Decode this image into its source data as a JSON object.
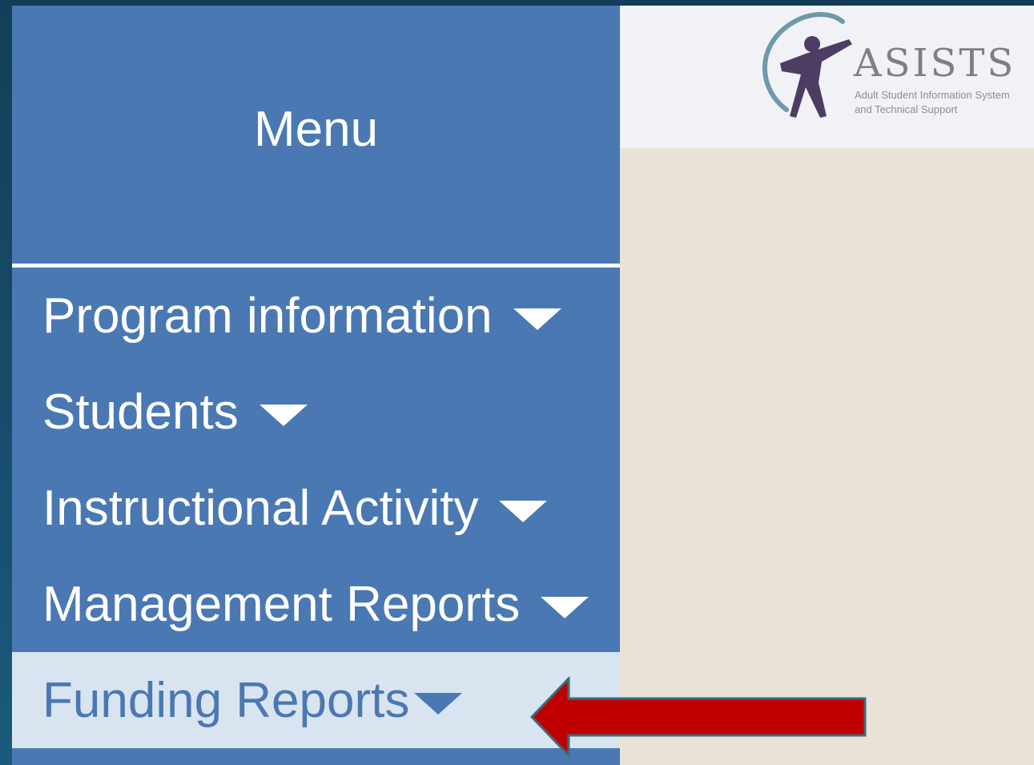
{
  "sidebar": {
    "title": "Menu",
    "items": [
      {
        "label": "Program information"
      },
      {
        "label": "Students"
      },
      {
        "label": "Instructional Activity"
      },
      {
        "label": "Management Reports"
      },
      {
        "label": "Funding Reports",
        "active": true
      }
    ]
  },
  "logo": {
    "name": "ASISTS",
    "tagline_line1": "Adult Student Information System",
    "tagline_line2": "and Technical Support",
    "icon": "person-figure-icon"
  },
  "annotation": {
    "icon": "left-arrow-icon",
    "color": "#c00000",
    "points_to": "Funding Reports"
  },
  "colors": {
    "sidebar": "#4a78b2",
    "active_item": "#d9e4f1",
    "content": "#ebe2d7",
    "header": "#f1f2f6"
  }
}
